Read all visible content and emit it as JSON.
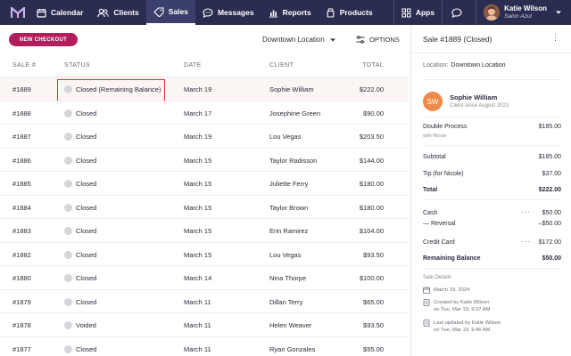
{
  "nav": {
    "items": [
      {
        "label": "Calendar",
        "icon": "calendar-icon"
      },
      {
        "label": "Clients",
        "icon": "clients-icon"
      },
      {
        "label": "Sales",
        "icon": "sales-tag-icon",
        "active": true
      },
      {
        "label": "Messages",
        "icon": "messages-icon"
      },
      {
        "label": "Reports",
        "icon": "reports-icon"
      },
      {
        "label": "Products",
        "icon": "products-icon"
      }
    ],
    "apps_label": "Apps",
    "user": {
      "name": "Katie Wilson",
      "location": "Salon Azul"
    }
  },
  "toolbar": {
    "new_checkout": "NEW CHECKOUT",
    "location": "Downtown Location",
    "options": "OPTIONS"
  },
  "table": {
    "headers": {
      "sale": "SALE #",
      "status": "STATUS",
      "date": "DATE",
      "client": "CLIENT",
      "total": "TOTAL"
    },
    "rows": [
      {
        "sale": "#1889",
        "status": "Closed (Remaining Balance)",
        "date": "March 19",
        "client": "Sophie William",
        "total": "$222.00"
      },
      {
        "sale": "#1888",
        "status": "Closed",
        "date": "March 17",
        "client": "Josephine Green",
        "total": "$90.00"
      },
      {
        "sale": "#1887",
        "status": "Closed",
        "date": "March 19",
        "client": "Lou Vegas",
        "total": "$203.50"
      },
      {
        "sale": "#1886",
        "status": "Closed",
        "date": "March 15",
        "client": "Taylor Radisson",
        "total": "$144.00"
      },
      {
        "sale": "#1885",
        "status": "Closed",
        "date": "March 15",
        "client": "Juliette Ferry",
        "total": "$180.00"
      },
      {
        "sale": "#1884",
        "status": "Closed",
        "date": "March 15",
        "client": "Taylor Brown",
        "total": "$180.00"
      },
      {
        "sale": "#1883",
        "status": "Closed",
        "date": "March 15",
        "client": "Erin Ramirez",
        "total": "$104.00"
      },
      {
        "sale": "#1882",
        "status": "Closed",
        "date": "March 15",
        "client": "Lou Vegas",
        "total": "$93.50"
      },
      {
        "sale": "#1880",
        "status": "Closed",
        "date": "March 14",
        "client": "Nina Thorpe",
        "total": "$100.00"
      },
      {
        "sale": "#1879",
        "status": "Closed",
        "date": "March 11",
        "client": "Dillan Terry",
        "total": "$65.00"
      },
      {
        "sale": "#1878",
        "status": "Voided",
        "date": "March 11",
        "client": "Helen Weaver",
        "total": "$93.50"
      },
      {
        "sale": "#1877",
        "status": "Closed",
        "date": "March 11",
        "client": "Ryan Gonzales",
        "total": "$55.00"
      }
    ]
  },
  "panel": {
    "title": "Sale #1889 (Closed)",
    "location_label": "Location:",
    "location_value": "Downtown Location",
    "client_initials": "SW",
    "client_name": "Sophie William",
    "client_since": "Client since August 2023",
    "service_name": "Double Process",
    "service_price": "$185.00",
    "service_staff": "with Nicole",
    "subtotal_label": "Subtotal",
    "subtotal_value": "$185.00",
    "tip_label": "Tip (for Nicole)",
    "tip_value": "$37.00",
    "total_label": "Total",
    "total_value": "$222.00",
    "cash_label": "Cash",
    "cash_value": "$50.00",
    "reversal_label": "— Reversal",
    "reversal_value": "–$50.00",
    "card_label": "Credit Card",
    "card_value": "$172.00",
    "remaining_label": "Remaining Balance",
    "remaining_value": "$50.00",
    "details_label": "Sale Details",
    "sale_date": "March 19, 2024",
    "created_line1": "Created by Katie Wilson",
    "created_line2": "on Tue, Mar 19, 9:37 AM",
    "updated_line1": "Last updated by Katie Wilson",
    "updated_line2": "on Tue, Mar 19, 9:46 AM"
  },
  "colors": {
    "nav_bg": "#2a2d50",
    "accent": "#b21d5e",
    "highlight": "#e0312f",
    "avatar": "#f08a4b"
  }
}
